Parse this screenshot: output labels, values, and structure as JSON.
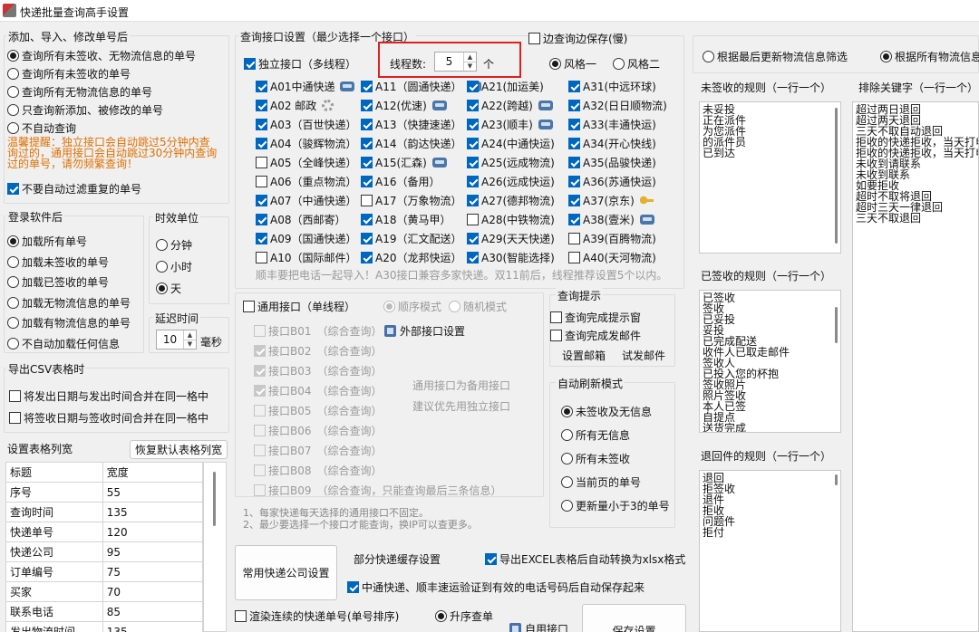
{
  "window": {
    "title": "快递批量查询高手设置"
  },
  "add_group": {
    "title": "添加、导入、修改单号后",
    "options": [
      {
        "label": "查询所有未签收、无物流信息的单号",
        "checked": true
      },
      {
        "label": "查询所有未签收的单号",
        "checked": false
      },
      {
        "label": "查询所有无物流信息的单号",
        "checked": false
      },
      {
        "label": "只查询新添加、被修改的单号",
        "checked": false
      },
      {
        "label": "不自动查询",
        "checked": false
      }
    ],
    "tip_lines": [
      "温馨提醒：独立接口会自动跳过5分钟内查",
      "询过的，通用接口会自动跳过30分钟内查询",
      "过的单号，请勿频繁查询！"
    ],
    "no_filter_dup": "不要自动过滤重复的单号"
  },
  "login_group": {
    "title": "登录软件后",
    "options": [
      {
        "label": "加载所有单号",
        "checked": true
      },
      {
        "label": "加载未签收的单号",
        "checked": false
      },
      {
        "label": "加载已签收的单号",
        "checked": false
      },
      {
        "label": "加载无物流信息的单号",
        "checked": false
      },
      {
        "label": "加载有物流信息的单号",
        "checked": false
      },
      {
        "label": "不自动加载任何信息",
        "checked": false
      }
    ]
  },
  "time_unit": {
    "title": "时效单位",
    "options": [
      {
        "label": "分钟",
        "checked": false
      },
      {
        "label": "小时",
        "checked": false
      },
      {
        "label": "天",
        "checked": true
      }
    ]
  },
  "delay": {
    "title": "延迟时间",
    "value": "10",
    "unit": "毫秒"
  },
  "csv": {
    "title": "导出CSV表格时",
    "merge_send": "将发出日期与发出时间合并在同一格中",
    "merge_sign": "将签收日期与签收时间合并在同一格中"
  },
  "col_width": {
    "title": "设置表格列宽",
    "reset_button": "恢复默认表格列宽",
    "headers": [
      "标题",
      "宽度"
    ],
    "rows": [
      [
        "序号",
        "55"
      ],
      [
        "查询时间",
        "135"
      ],
      [
        "快递单号",
        "120"
      ],
      [
        "快递公司",
        "95"
      ],
      [
        "订单编号",
        "75"
      ],
      [
        "买家",
        "70"
      ],
      [
        "联系电话",
        "85"
      ],
      [
        "发出物流时间",
        "135"
      ]
    ]
  },
  "query": {
    "title": "查询接口设置（最少选择一个接口）",
    "save_while": "边查询边保存(慢)",
    "independent": "独立接口（多线程）",
    "threads_label": "线程数:",
    "threads_value": "5",
    "threads_unit": "个",
    "style1": "风格一",
    "style2": "风格二",
    "col1": [
      {
        "label": "A01中通快递",
        "checked": true,
        "icon": "phone-icon"
      },
      {
        "label": "A02  邮政",
        "checked": true,
        "icon": "gear-icon"
      },
      {
        "label": "A03（百世快递）",
        "checked": true
      },
      {
        "label": "A04（骏辉物流）",
        "checked": true
      },
      {
        "label": "A05（全峰快递）",
        "checked": false
      },
      {
        "label": "A06（重点物流）",
        "checked": false
      },
      {
        "label": "A07（中通快递）",
        "checked": true
      },
      {
        "label": "A08（西邮寄）",
        "checked": true
      },
      {
        "label": "A09（国通快递）",
        "checked": true
      },
      {
        "label": "A10（国际邮件）",
        "checked": false
      }
    ],
    "col2": [
      {
        "label": "A11（圆通快递）",
        "checked": true,
        "icon": "phone-icon"
      },
      {
        "label": "A12(优速)",
        "checked": true,
        "icon": "phone-icon"
      },
      {
        "label": "A13（快捷速递）",
        "checked": true
      },
      {
        "label": "A14（韵达快递）",
        "checked": true
      },
      {
        "label": "A15(汇森)",
        "checked": true,
        "icon": "phone-icon"
      },
      {
        "label": "A16（备用）",
        "checked": true
      },
      {
        "label": "A17（万象物流）",
        "checked": false
      },
      {
        "label": "A18（黄马甲）",
        "checked": true
      },
      {
        "label": "A19（汇文配送）",
        "checked": true
      },
      {
        "label": "A20（龙邦快运）",
        "checked": true
      }
    ],
    "col3": [
      {
        "label": "A21(加运美)",
        "checked": true
      },
      {
        "label": "A22(跨越)",
        "checked": true,
        "icon": "phone-icon"
      },
      {
        "label": "A23(顺丰)",
        "checked": true,
        "icon": "phone-icon"
      },
      {
        "label": "A24(中通快运)",
        "checked": true
      },
      {
        "label": "A25(远成物流)",
        "checked": true
      },
      {
        "label": "A26(远成快运)",
        "checked": true
      },
      {
        "label": "A27(德邦物流)",
        "checked": true
      },
      {
        "label": "A28(中铁物流)",
        "checked": false
      },
      {
        "label": "A29(天天快递)",
        "checked": true
      },
      {
        "label": "A30(智能选择)",
        "checked": true
      }
    ],
    "col4": [
      {
        "label": "A31(中远环球)",
        "checked": true
      },
      {
        "label": "A32(日日顺物流)",
        "checked": true
      },
      {
        "label": "A33(丰通快运)",
        "checked": true
      },
      {
        "label": "A34(开心快线)",
        "checked": true
      },
      {
        "label": "A35(品骏快递)",
        "checked": true
      },
      {
        "label": "A36(苏通快运)",
        "checked": true
      },
      {
        "label": "A37(京东)",
        "checked": true,
        "icon": "key-icon"
      },
      {
        "label": "A38(壹米)",
        "checked": true,
        "icon": "phone-icon"
      },
      {
        "label": "A39(百腾物流)",
        "checked": false
      },
      {
        "label": "A40(天河物流)",
        "checked": false
      }
    ],
    "hint": "顺丰要把电话一起导入！A30接口兼容多家快递。双11前后，线程推荐设置5个以内。"
  },
  "general": {
    "title": "通用接口（单线程）",
    "seq_mode": "顺序模式",
    "rand_mode": "随机模式",
    "items": [
      {
        "name": "接口B01",
        "desc": "（综合查询）",
        "checked": false
      },
      {
        "name": "接口B02",
        "desc": "（综合查询）",
        "checked": true
      },
      {
        "name": "接口B03",
        "desc": "（综合查询）",
        "checked": true
      },
      {
        "name": "接口B04",
        "desc": "（综合查询）",
        "checked": true
      },
      {
        "name": "接口B05",
        "desc": "（综合查询）",
        "checked": false
      },
      {
        "name": "接口B06",
        "desc": "（综合查询）",
        "checked": false
      },
      {
        "name": "接口B07",
        "desc": "（综合查询）",
        "checked": false
      },
      {
        "name": "接口B08",
        "desc": "（综合查询）",
        "checked": false
      },
      {
        "name": "接口B09",
        "desc": "（综合查询，只能查询最后三条信息）",
        "checked": false
      }
    ],
    "external": "外部接口设置",
    "backup_line1": "通用接口为备用接口",
    "backup_line2": "建议优先用独立接口"
  },
  "notes": [
    "1、每家快递每天选择的通用接口不固定。",
    "2、最少要选择一个接口才能查询，换IP可以查更多。"
  ],
  "query_tip": {
    "title": "查询提示",
    "popup": "查询完成提示窗",
    "mail": "查询完成发邮件",
    "set_mail": "设置邮箱",
    "test_mail": "试发邮件"
  },
  "refresh": {
    "title": "自动刷新模式",
    "options": [
      {
        "label": "未签收及无信息",
        "checked": true
      },
      {
        "label": "所有无信息",
        "checked": false
      },
      {
        "label": "所有未签收",
        "checked": false
      },
      {
        "label": "当前页的单号",
        "checked": false
      },
      {
        "label": "更新量小于3的单号",
        "checked": false
      }
    ]
  },
  "bottom": {
    "common_company": "常用快递公司设置",
    "partial_cache": "部分快递缓存设置",
    "export_xlsx": "导出EXCEL表格后自动转换为xlsx格式",
    "auto_save_phone": "中通快递、顺丰速运验证到有效的电话号码后自动保存起来",
    "render_continuous": "渲染连续的快递单号(单号排序)",
    "ascending": "升序查单",
    "self_api": "自用接口",
    "save": "保存设置"
  },
  "filter": {
    "by_latest": "根据最后更新物流信息筛选",
    "by_all": "根据所有物流信息"
  },
  "rules": {
    "unsigned_title": "未签收的规则（一行一个）",
    "unsigned": [
      "未妥投",
      "正在派件",
      "为您派件",
      "的派件员",
      "已到达"
    ],
    "exclude_title": "排除关键字（一行一个）",
    "exclude": [
      "超过两日退回",
      "超过两天退回",
      "三天不取自动退回",
      "拒收的快递拒收，当天打电",
      "拒收的快递拒收，当天打电",
      "未收到请联系",
      "未收到联系",
      "如要拒收",
      "超时不取将退回",
      "超时三天一律退回",
      "三天不取退回"
    ],
    "signed_title": "已签收的规则（一行一个）",
    "signed": [
      "已签收",
      "签收",
      "已妥投",
      "妥投",
      "已完成配送",
      "收件人已取走邮件",
      "签收人",
      "已投入您的杯抱",
      "签收照片",
      "照片签收",
      "本人已签",
      "自提点",
      "送货完成"
    ],
    "returned_title": "退回件的规则（一行一个）",
    "returned": [
      "退回",
      "拒签收",
      "退件",
      "拒收",
      "问题件",
      "拒付"
    ]
  }
}
